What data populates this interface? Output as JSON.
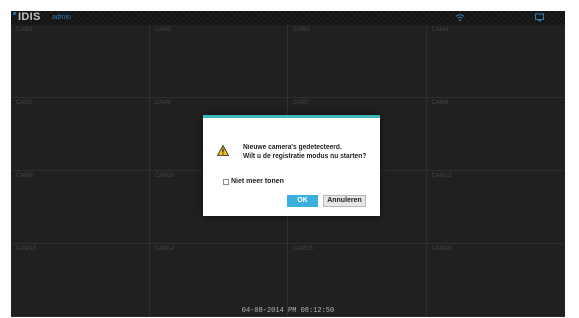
{
  "brand": {
    "logo": "IDIS",
    "user": "admin"
  },
  "status": {
    "wifi_icon": "wifi-icon",
    "monitor_icon": "monitor-icon"
  },
  "cameras": [
    "CAM1",
    "CAM2",
    "CAM3",
    "CAM4",
    "CAM5",
    "CAM6",
    "CAM7",
    "CAM8",
    "CAM9",
    "CAM10",
    "CAM11",
    "CAM12",
    "CAM13",
    "CAM14",
    "CAM15",
    "CAM16"
  ],
  "datetime": "04-08-2014  PM 08:12:50",
  "dialog": {
    "icon": "warning-icon",
    "accent_color": "#3cb7c0",
    "line1": "Nieuwe camera's gedetecteerd.",
    "line2": "Wilt u de registratie modus nu starten?",
    "checkbox_label": "Niet meer tonen",
    "ok_label": "OK",
    "cancel_label": "Annuleren"
  }
}
